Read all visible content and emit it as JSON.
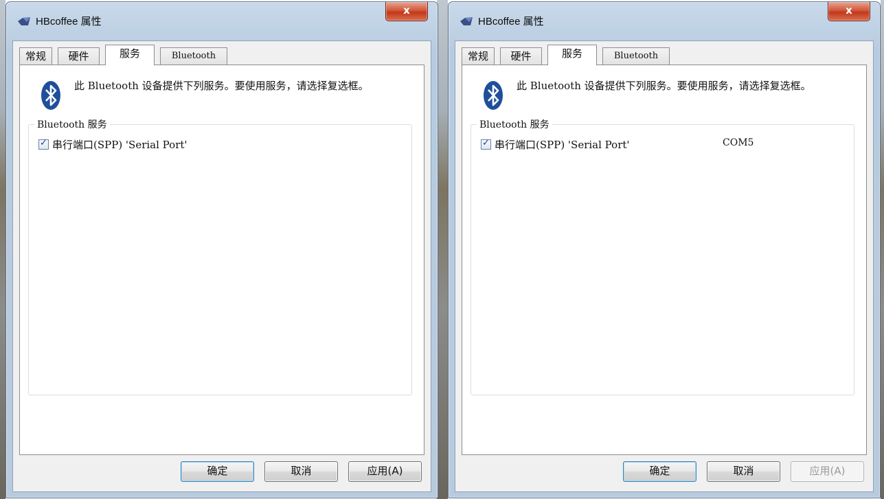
{
  "windows": [
    {
      "title": "HBcoffee 属性",
      "close_label": "x",
      "tabs": [
        "常规",
        "硬件",
        "服务",
        "Bluetooth"
      ],
      "active_tab": "服务",
      "description": "此 Bluetooth 设备提供下列服务。要使用服务，请选择复选框。",
      "group_title": "Bluetooth 服务",
      "services": [
        {
          "label": "串行端口(SPP) 'Serial Port'",
          "checked": true,
          "port": ""
        }
      ],
      "buttons": {
        "ok": "确定",
        "cancel": "取消",
        "apply": "应用(A)"
      },
      "apply_enabled": true
    },
    {
      "title": "HBcoffee 属性",
      "close_label": "x",
      "tabs": [
        "常规",
        "硬件",
        "服务",
        "Bluetooth"
      ],
      "active_tab": "服务",
      "description": "此 Bluetooth 设备提供下列服务。要使用服务，请选择复选框。",
      "group_title": "Bluetooth 服务",
      "services": [
        {
          "label": "串行端口(SPP) 'Serial Port'",
          "checked": true,
          "port": "COM5"
        }
      ],
      "buttons": {
        "ok": "确定",
        "cancel": "取消",
        "apply": "应用(A)"
      },
      "apply_enabled": false
    }
  ],
  "colors": {
    "accent_bluetooth": "#1f4f9a",
    "close_button": "#c2391b",
    "window_frame": "#b8cadd"
  },
  "icons": [
    "bluetooth-icon",
    "app-icon",
    "close-icon",
    "checkmark-icon"
  ]
}
